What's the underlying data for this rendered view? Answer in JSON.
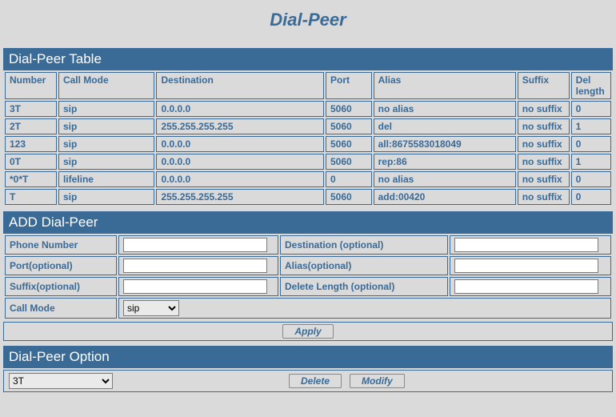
{
  "page_title": "Dial-Peer",
  "sections": {
    "table_title": "Dial-Peer Table",
    "add_title": "ADD Dial-Peer",
    "option_title": "Dial-Peer Option"
  },
  "table": {
    "headers": {
      "number": "Number",
      "call_mode": "Call Mode",
      "destination": "Destination",
      "port": "Port",
      "alias": "Alias",
      "suffix": "Suffix",
      "del_length": "Del length"
    },
    "rows": [
      {
        "number": "3T",
        "call_mode": "sip",
        "destination": "0.0.0.0",
        "port": "5060",
        "alias": "no alias",
        "suffix": "no suffix",
        "del_length": "0"
      },
      {
        "number": "2T",
        "call_mode": "sip",
        "destination": "255.255.255.255",
        "port": "5060",
        "alias": "del",
        "suffix": "no suffix",
        "del_length": "1"
      },
      {
        "number": "123",
        "call_mode": "sip",
        "destination": "0.0.0.0",
        "port": "5060",
        "alias": "all:8675583018049",
        "suffix": "no suffix",
        "del_length": "0"
      },
      {
        "number": "0T",
        "call_mode": "sip",
        "destination": "0.0.0.0",
        "port": "5060",
        "alias": "rep:86",
        "suffix": "no suffix",
        "del_length": "1"
      },
      {
        "number": "*0*T",
        "call_mode": "lifeline",
        "destination": "0.0.0.0",
        "port": "0",
        "alias": "no alias",
        "suffix": "no suffix",
        "del_length": "0"
      },
      {
        "number": "T",
        "call_mode": "sip",
        "destination": "255.255.255.255",
        "port": "5060",
        "alias": "add:00420",
        "suffix": "no suffix",
        "del_length": "0"
      }
    ]
  },
  "form": {
    "labels": {
      "phone_number": "Phone Number",
      "destination": "Destination (optional)",
      "port": "Port(optional)",
      "alias": "Alias(optional)",
      "suffix": "Suffix(optional)",
      "delete_length": "Delete Length (optional)",
      "call_mode": "Call Mode"
    },
    "values": {
      "phone_number": "",
      "destination": "",
      "port": "",
      "alias": "",
      "suffix": "",
      "delete_length": ""
    },
    "call_mode_selected": "sip",
    "call_mode_options": [
      "sip"
    ]
  },
  "buttons": {
    "apply": "Apply",
    "delete": "Delete",
    "modify": "Modify"
  },
  "option": {
    "selected": "3T"
  }
}
